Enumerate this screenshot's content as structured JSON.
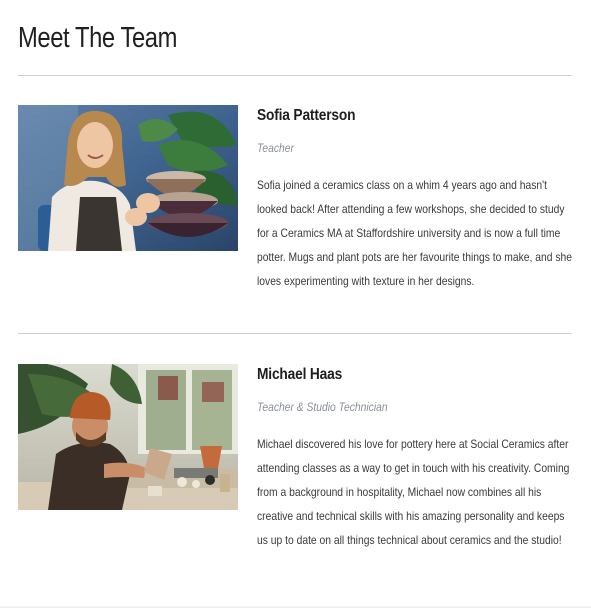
{
  "page": {
    "title": "Meet The Team"
  },
  "team": [
    {
      "name": "Sofia Patterson",
      "role": "Teacher",
      "bio": "Sofia joined a ceramics class on a whim 4 years ago and hasn't looked back! After attending a few workshops, she decided to study for a Ceramics MA at Staffordshire university and is now a full time potter. Mugs and plant pots are her favourite things to make, and she loves experimenting with texture in her designs.",
      "photo_alt": "Sofia holding stacked ceramic bowls"
    },
    {
      "name": "Michael Haas",
      "role": "Teacher & Studio Technician",
      "bio": "Michael discovered his love for pottery here at Social Ceramics after attending classes as a way to get in touch with his creativity. Coming from a background in hospitality, Michael now combines all his creative and technical skills with his amazing personality and keeps us up to date on all things technical about ceramics and the studio!",
      "photo_alt": "Michael working on pottery at a studio table"
    }
  ],
  "colors": {
    "divider": "#cfcfcf",
    "role_text": "#8a8f99",
    "body_text": "#3a3a3a"
  }
}
